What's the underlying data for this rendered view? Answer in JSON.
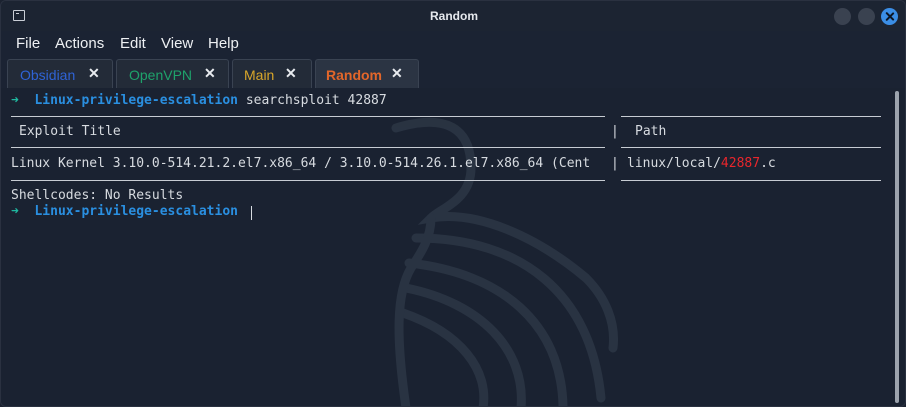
{
  "window": {
    "title": "Random"
  },
  "menu": [
    "File",
    "Actions",
    "Edit",
    "View",
    "Help"
  ],
  "tabs": [
    {
      "label": "Obsidian",
      "color": "#2f63d6"
    },
    {
      "label": "OpenVPN",
      "color": "#1ea36b"
    },
    {
      "label": "Main",
      "color": "#d8a62a"
    },
    {
      "label": "Random",
      "color": "#e2662a"
    }
  ],
  "tab_close_glyph": "✕",
  "prompt": {
    "arrow": "➜",
    "directory": "Linux-privilege-escalation",
    "command": "searchsploit 42887"
  },
  "results": {
    "header_title": "Exploit Title",
    "header_sep": "|",
    "header_path": "Path",
    "row_title": "Linux Kernel 3.10.0-514.21.2.el7.x86_64 / 3.10.0-514.26.1.el7.x86_64 (Cent",
    "row_sep": "|",
    "row_path_prefix": "linux/local/",
    "row_path_highlight": "42887",
    "row_path_suffix": ".c",
    "shellcodes": "Shellcodes: No Results"
  },
  "colors": {
    "accent": "#3b8ee6",
    "highlight": "#e8262c",
    "prompt_arrow": "#1fb8a0",
    "directory": "#2a8fe0"
  }
}
